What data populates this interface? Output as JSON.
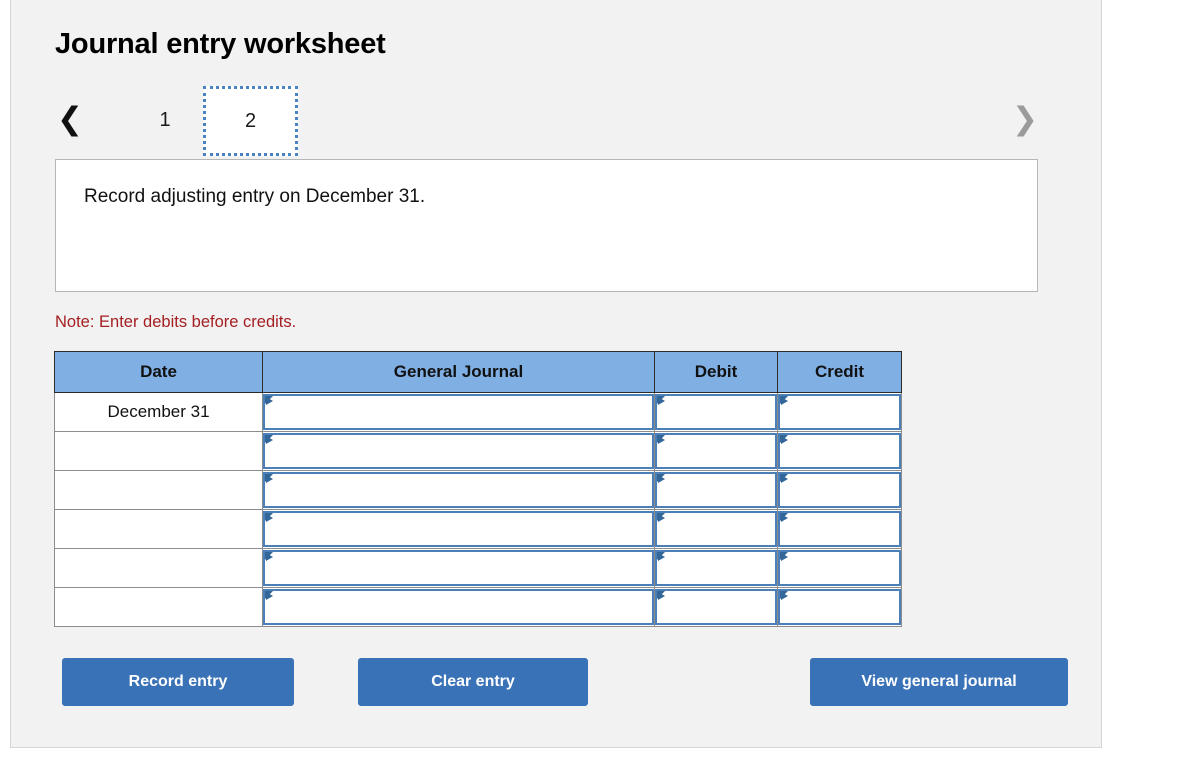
{
  "worksheet": {
    "title": "Journal entry worksheet",
    "instruction": "Record adjusting entry on December 31.",
    "note": "Note: Enter debits before credits."
  },
  "pager": {
    "prev_icon": "chevron-left-icon",
    "next_icon": "chevron-right-icon",
    "prev_glyph": "❮",
    "next_glyph": "❯",
    "tabs": [
      {
        "label": "1",
        "active": false
      },
      {
        "label": "2",
        "active": true
      }
    ]
  },
  "table": {
    "columns": [
      "Date",
      "General Journal",
      "Debit",
      "Credit"
    ],
    "rows": [
      {
        "date": "December 31",
        "general_journal": "",
        "debit": "",
        "credit": ""
      },
      {
        "date": "",
        "general_journal": "",
        "debit": "",
        "credit": ""
      },
      {
        "date": "",
        "general_journal": "",
        "debit": "",
        "credit": ""
      },
      {
        "date": "",
        "general_journal": "",
        "debit": "",
        "credit": ""
      },
      {
        "date": "",
        "general_journal": "",
        "debit": "",
        "credit": ""
      },
      {
        "date": "",
        "general_journal": "",
        "debit": "",
        "credit": ""
      }
    ]
  },
  "buttons": {
    "record": "Record entry",
    "clear": "Clear entry",
    "view": "View general journal"
  },
  "colors": {
    "header_blue": "#7fafe3",
    "button_blue": "#3a72b8",
    "note_red": "#a41e22",
    "field_border": "#4a7fb8",
    "focus_blue": "#4a83c4",
    "panel_bg": "#f2f2f2"
  }
}
